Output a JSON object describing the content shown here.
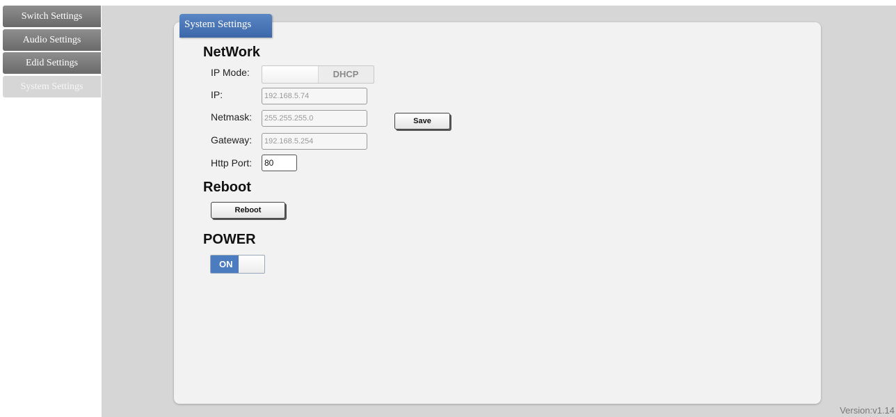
{
  "sidebar": {
    "items": [
      {
        "label": "Switch Settings"
      },
      {
        "label": "Audio Settings"
      },
      {
        "label": "Edid Settings"
      },
      {
        "label": "System Settings"
      }
    ]
  },
  "panel": {
    "tab_label": "System Settings"
  },
  "network": {
    "heading": "NetWork",
    "ip_mode_label": "IP Mode:",
    "ip_mode_value": "DHCP",
    "ip_label": "IP:",
    "ip_value": "192.168.5.74",
    "netmask_label": "Netmask:",
    "netmask_value": "255.255.255.0",
    "gateway_label": "Gateway:",
    "gateway_value": "192.168.5.254",
    "http_port_label": "Http Port:",
    "http_port_value": "80",
    "save_label": "Save"
  },
  "reboot": {
    "heading": "Reboot",
    "button_label": "Reboot"
  },
  "power": {
    "heading": "POWER",
    "state_label": "ON"
  },
  "footer": {
    "version": "Version:v1.14"
  },
  "colors": {
    "accent": "#4c7cc0",
    "sidebar_dark": "#7a7a7a",
    "background": "#d6d6d6"
  }
}
